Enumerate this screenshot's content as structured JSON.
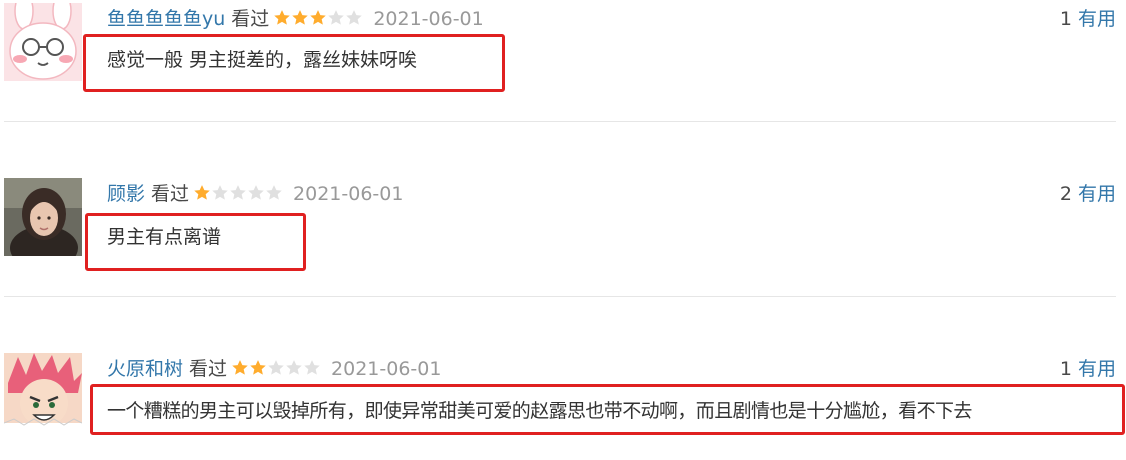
{
  "reviews": [
    {
      "username": "鱼鱼鱼鱼鱼yu",
      "status": "看过",
      "rating": 3,
      "rating_max": 5,
      "date": "2021-06-01",
      "useful_count": "1",
      "useful_label": "有用",
      "comment": "感觉一般 男主挺差的，露丝妹妹呀唉",
      "avatar_icon": "pink-rabbit-avatar"
    },
    {
      "username": "顾影",
      "status": "看过",
      "rating": 1,
      "rating_max": 5,
      "date": "2021-06-01",
      "useful_count": "2",
      "useful_label": "有用",
      "comment": "男主有点离谱",
      "avatar_icon": "woman-photo-avatar"
    },
    {
      "username": "火原和树",
      "status": "看过",
      "rating": 2,
      "rating_max": 5,
      "date": "2021-06-01",
      "useful_count": "1",
      "useful_label": "有用",
      "comment": "一个糟糕的男主可以毁掉所有，即使异常甜美可爱的赵露思也带不动啊，而且剧情也是十分尴尬，看不下去",
      "avatar_icon": "anime-boy-avatar"
    }
  ],
  "colors": {
    "username": "#3377aa",
    "useful_label": "#3377aa",
    "date": "#999999",
    "star_filled": "#ffac2d",
    "star_empty": "#e0e0e0",
    "highlight_box": "#e02020"
  }
}
